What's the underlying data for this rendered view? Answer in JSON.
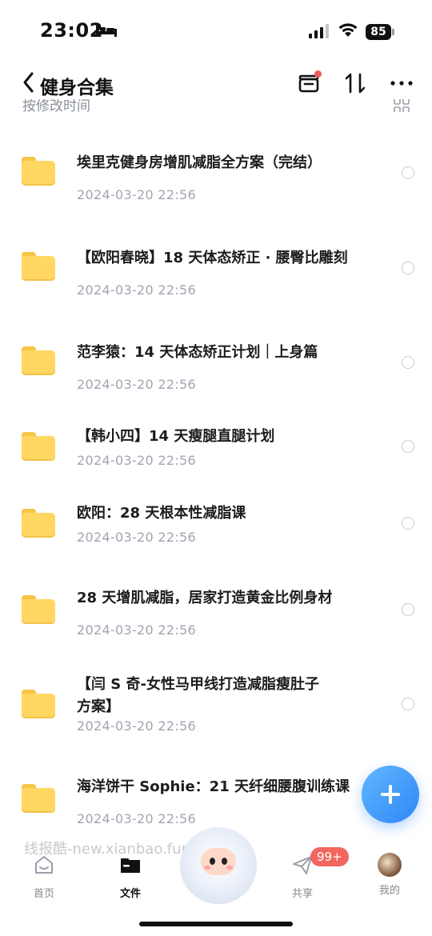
{
  "status_bar": {
    "time": "23:02",
    "battery": "85"
  },
  "header": {
    "title": "健身合集",
    "back_label": "<"
  },
  "sort": {
    "label": "按修改时间"
  },
  "files": [
    {
      "name": "埃里克健身房增肌减脂全方案（完结）",
      "date": "2024-03-20 22:56"
    },
    {
      "name": "【欧阳春晓】18 天体态矫正 · 腰臀比雕刻",
      "date": "2024-03-20 22:56"
    },
    {
      "name": "范李猿：14 天体态矫正计划｜上身篇",
      "date": "2024-03-20 22:56"
    },
    {
      "name": "【韩小四】14 天瘦腿直腿计划",
      "date": "2024-03-20 22:56"
    },
    {
      "name": "欧阳：28 天根本性减脂课",
      "date": "2024-03-20 22:56"
    },
    {
      "name": "28 天增肌减脂，居家打造黄金比例身材",
      "date": "2024-03-20 22:56"
    },
    {
      "name": "【闫 S 奇-女性马甲线打造减脂瘦肚子方案】",
      "date": "2024-03-20 22:56"
    },
    {
      "name": "海洋饼干 Sophie：21 天纤细腰腹训练课",
      "date": "2024-03-20 22:56"
    }
  ],
  "watermark": "线报酷-new.xianbao.fun",
  "tabs": {
    "home": "首页",
    "files": "文件",
    "share": "共享",
    "mine": "我的",
    "share_badge": "99+"
  },
  "colors": {
    "accent": "#2f86f7",
    "folder": "#ffd762",
    "badge": "#f2665f"
  }
}
